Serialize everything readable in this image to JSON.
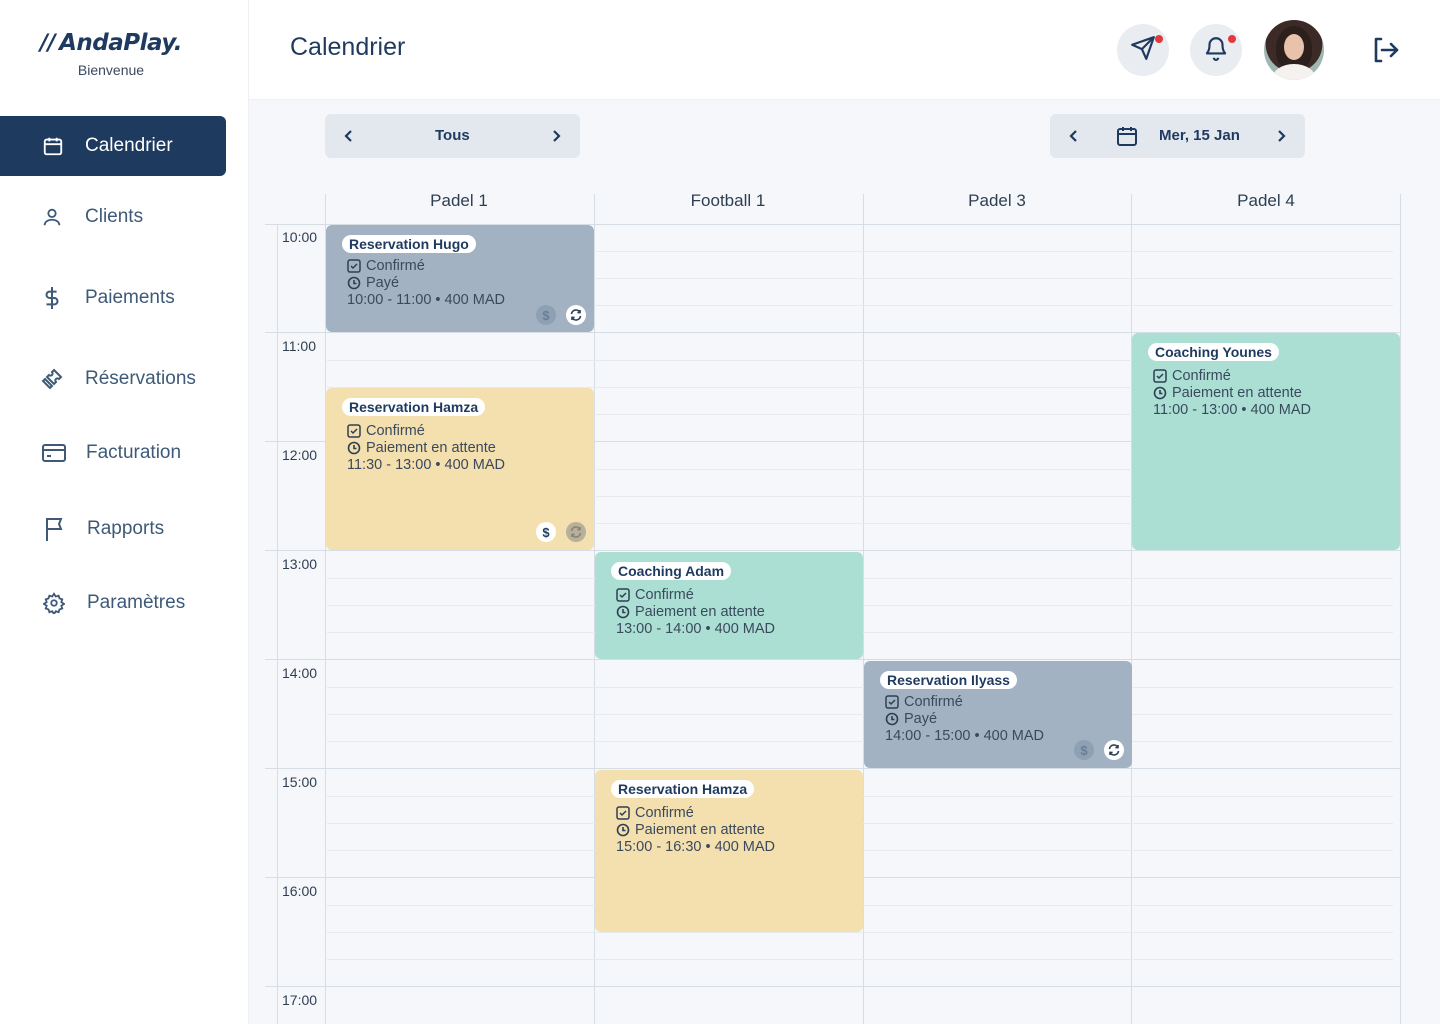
{
  "app": {
    "logo": "AndaPlay.",
    "welcome": "Bienvenue"
  },
  "sidebar": {
    "items": [
      {
        "label": "Calendrier",
        "icon": "calendar-icon",
        "active": true
      },
      {
        "label": "Clients",
        "icon": "user-icon",
        "active": false
      },
      {
        "label": "Paiements",
        "icon": "dollar-icon",
        "active": false
      },
      {
        "label": "Réservations",
        "icon": "ticket-icon",
        "active": false
      },
      {
        "label": "Facturation",
        "icon": "credit-card-icon",
        "active": false
      },
      {
        "label": "Rapports",
        "icon": "flag-icon",
        "active": false
      },
      {
        "label": "Paramètres",
        "icon": "gear-icon",
        "active": false
      }
    ]
  },
  "header": {
    "title": "Calendrier",
    "icons": [
      "send-icon",
      "bell-icon",
      "avatar",
      "logout-icon"
    ]
  },
  "filters": {
    "venue": "Tous",
    "date": "Mer, 15 Jan"
  },
  "calendar": {
    "columns": [
      "Padel 1",
      "Football 1",
      "Padel 3",
      "Padel 4"
    ],
    "times": [
      "10:00",
      "11:00",
      "12:00",
      "13:00",
      "14:00",
      "15:00",
      "16:00",
      "17:00"
    ],
    "events": [
      {
        "title": "Reservation Hugo",
        "status": "Confirmé",
        "payment": "Payé",
        "details": "10:00 - 11:00 • 400 MAD",
        "color": "#a3b2c2"
      },
      {
        "title": "Reservation Hamza",
        "status": "Confirmé",
        "payment": "Paiement en attente",
        "details": "11:30 - 13:00 • 400 MAD",
        "color": "#f4dfae"
      },
      {
        "title": "Coaching Younes",
        "status": "Confirmé",
        "payment": "Paiement en attente",
        "details": "11:00 - 13:00 • 400 MAD",
        "color": "#acdfd4"
      },
      {
        "title": "Coaching Adam",
        "status": "Confirmé",
        "payment": "Paiement en attente",
        "details": "13:00 - 14:00 • 400 MAD",
        "color": "#acdfd4"
      },
      {
        "title": "Reservation Ilyass",
        "status": "Confirmé",
        "payment": "Payé",
        "details": "14:00 - 15:00 • 400 MAD",
        "color": "#a3b2c2"
      },
      {
        "title": "Reservation Hamza",
        "status": "Confirmé",
        "payment": "Paiement en attente",
        "details": "15:00 - 16:30 • 400 MAD",
        "color": "#f4dfae"
      }
    ],
    "badges": {
      "dollar": "$"
    }
  }
}
